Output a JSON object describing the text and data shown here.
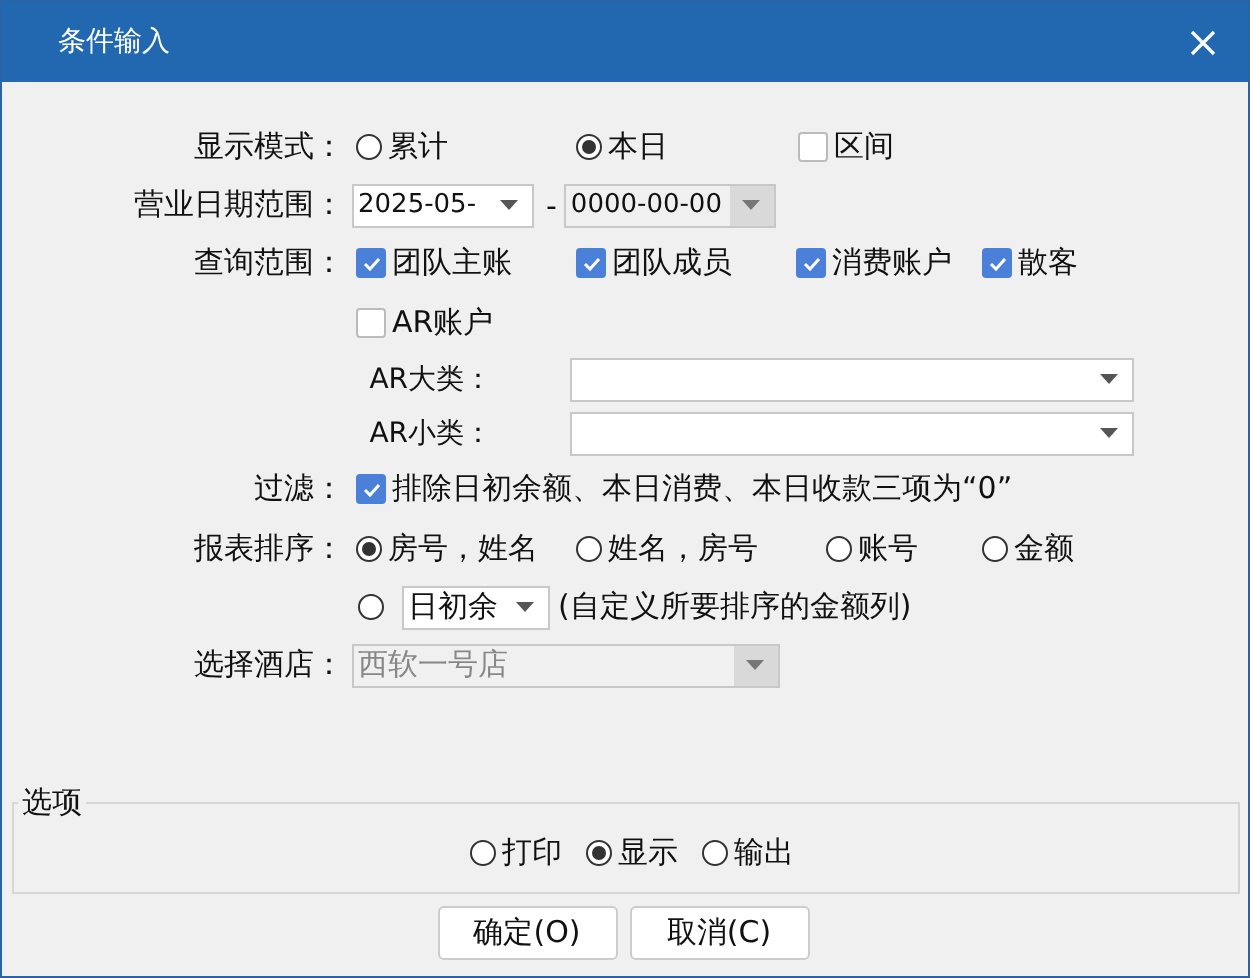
{
  "window": {
    "title": "条件输入"
  },
  "display_mode": {
    "label": "显示模式：",
    "options": [
      {
        "label": "累计",
        "kind": "radio",
        "selected": false
      },
      {
        "label": "本日",
        "kind": "radio",
        "selected": true
      },
      {
        "label": "区间",
        "kind": "checkbox",
        "checked": false
      }
    ]
  },
  "date_range": {
    "label": "营业日期范围：",
    "start": "2025-05-",
    "separator": "-",
    "end": "0000-00-00",
    "end_disabled": true
  },
  "scope": {
    "label": "查询范围：",
    "items": [
      {
        "label": "团队主账",
        "checked": true
      },
      {
        "label": "团队成员",
        "checked": true
      },
      {
        "label": "消费账户",
        "checked": true
      },
      {
        "label": "散客",
        "checked": true
      },
      {
        "label": "AR账户",
        "checked": false
      }
    ]
  },
  "ar_major": {
    "label": "AR大类："
  },
  "ar_minor": {
    "label": "AR小类："
  },
  "filter": {
    "label": "过滤：",
    "checked": true,
    "text": "排除日初余额、本日消费、本日收款三项为“0”"
  },
  "sort": {
    "label": "报表排序：",
    "options": [
      {
        "label": "房号，姓名",
        "selected": true
      },
      {
        "label": "姓名，房号",
        "selected": false
      },
      {
        "label": "账号",
        "selected": false
      },
      {
        "label": "金额",
        "selected": false
      }
    ],
    "custom": {
      "selected": false,
      "value": "日初余",
      "note": "(自定义所要排序的金额列)"
    }
  },
  "hotel": {
    "label": "选择酒店：",
    "value": "西软一号店",
    "disabled": true
  },
  "options": {
    "title": "选项",
    "items": [
      {
        "label": "打印",
        "selected": false
      },
      {
        "label": "显示",
        "selected": true
      },
      {
        "label": "输出",
        "selected": false
      }
    ]
  },
  "buttons": [
    "确定(O)",
    "取消(C)"
  ]
}
